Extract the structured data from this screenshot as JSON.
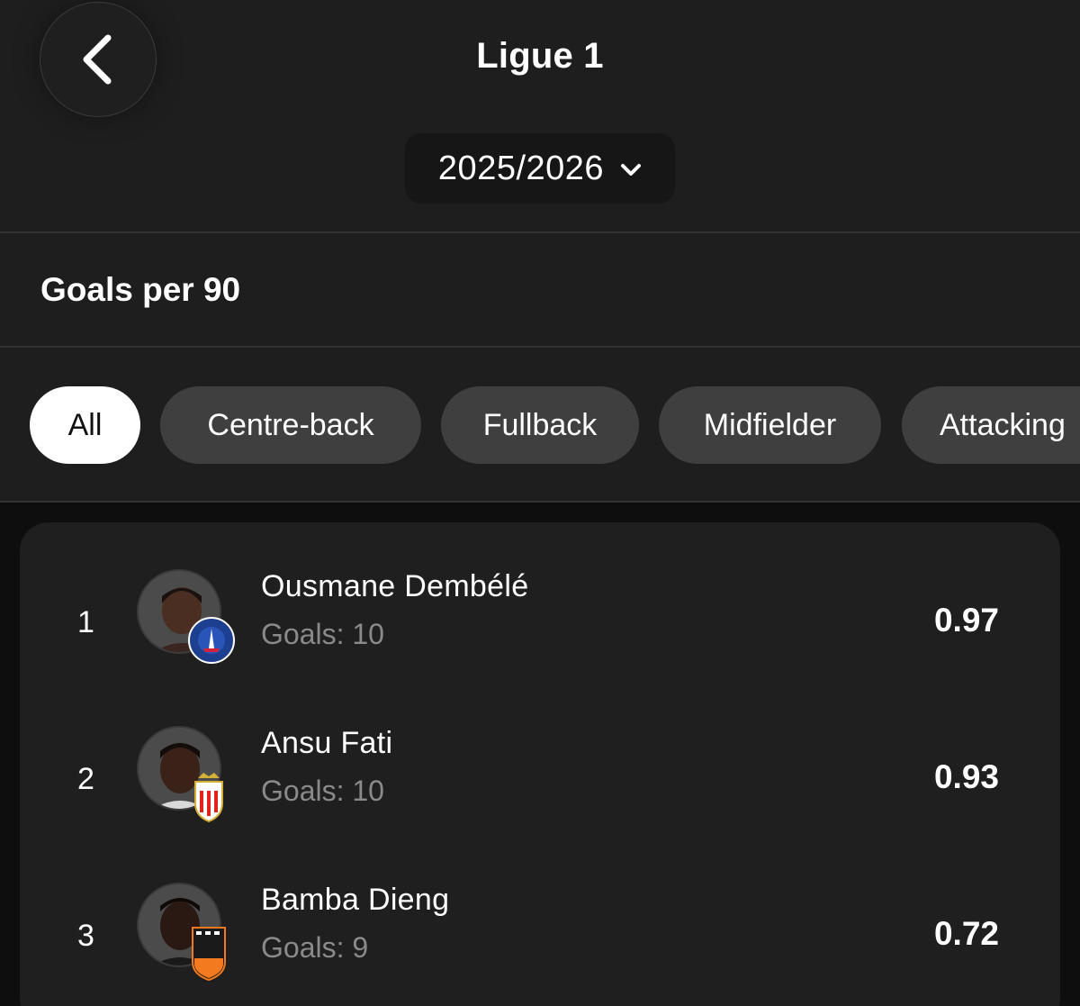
{
  "header": {
    "back_icon": "chevron-left-icon",
    "title": "Ligue 1",
    "season": {
      "selected": "2025/2026",
      "icon": "chevron-down-icon"
    }
  },
  "stat_selector": {
    "label": "Goals per 90",
    "icon": "chevron-down-icon"
  },
  "filters": {
    "chips": [
      {
        "label": "All",
        "active": true
      },
      {
        "label": "Centre-back",
        "active": false
      },
      {
        "label": "Fullback",
        "active": false
      },
      {
        "label": "Midfielder",
        "active": false
      },
      {
        "label": "Attacking",
        "active": false
      }
    ]
  },
  "leaderboard": {
    "goals_label": "Goals:",
    "players": [
      {
        "rank": "1",
        "name": "Ousmane Dembélé",
        "goals": "10",
        "value": "0.97",
        "club_badge": "psg-crest"
      },
      {
        "rank": "2",
        "name": "Ansu Fati",
        "goals": "10",
        "value": "0.93",
        "club_badge": "monaco-crest"
      },
      {
        "rank": "3",
        "name": "Bamba Dieng",
        "goals": "9",
        "value": "0.72",
        "club_badge": "lorient-crest"
      }
    ]
  },
  "colors": {
    "background": "#1e1e1e",
    "card": "#1f1f1f",
    "chip": "#3f3f3f",
    "chip_active": "#ffffff",
    "muted_text": "#8a8a8a"
  }
}
